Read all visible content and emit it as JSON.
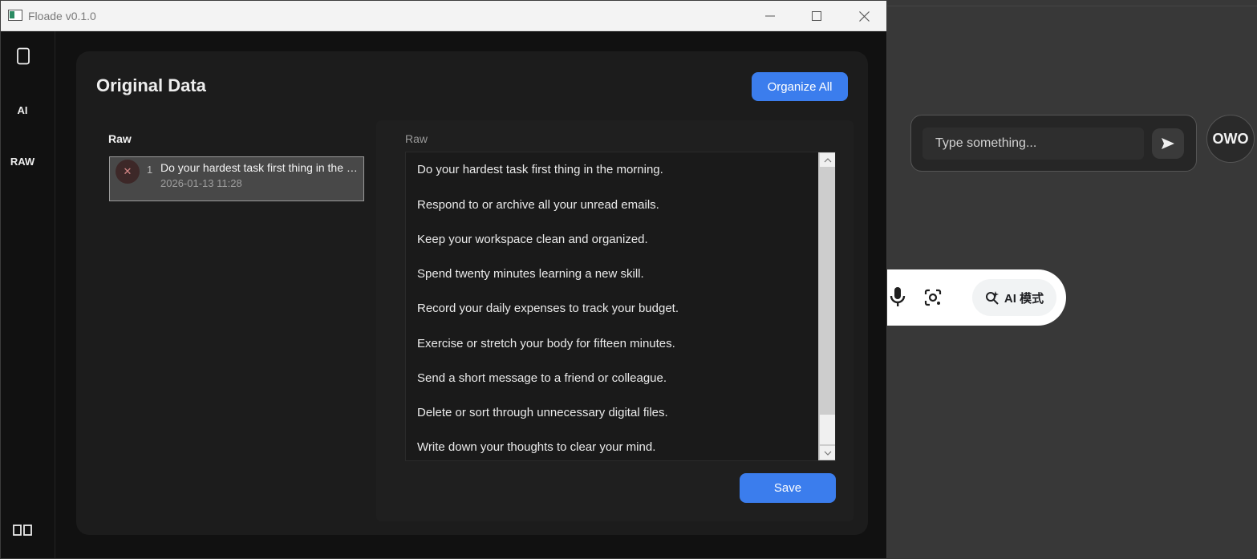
{
  "window": {
    "title": "Floade v0.1.0",
    "controls": {
      "minimize": "minimize-icon",
      "maximize": "maximize-icon",
      "close": "close-icon"
    }
  },
  "sidebar": {
    "items": [
      {
        "label": "",
        "icon": "notebook-icon"
      },
      {
        "label": "AI"
      },
      {
        "label": "RAW"
      },
      {
        "label": "",
        "icon": "layout-columns-icon"
      }
    ]
  },
  "main": {
    "title": "Original Data",
    "organize_all_label": "Organize All",
    "left_panel": {
      "label": "Raw",
      "entries": [
        {
          "index": "1",
          "text": "Do your hardest task first thing in the morning.",
          "date": "2026-01-13 11:28",
          "delete_glyph": "✕"
        }
      ]
    },
    "right_panel": {
      "label": "Raw",
      "lines": [
        "Do your hardest task first thing in the morning.",
        "Respond to or archive all your unread emails.",
        "Keep your workspace clean and organized.",
        "Spend twenty minutes learning a new skill.",
        "Record your daily expenses to track your budget.",
        "Exercise or stretch your body for fifteen minutes.",
        "Send a short message to a friend or colleague.",
        "Delete or sort through unnecessary digital files.",
        "Write down your thoughts to clear your mind."
      ],
      "save_label": "Save"
    }
  },
  "background": {
    "chat_placeholder": "Type something...",
    "owo_label": "OWO",
    "ai_mode_label": "AI 模式"
  },
  "colors": {
    "accent": "#3b7ded",
    "window_bg": "#111111",
    "card_bg": "#1c1c1c"
  }
}
